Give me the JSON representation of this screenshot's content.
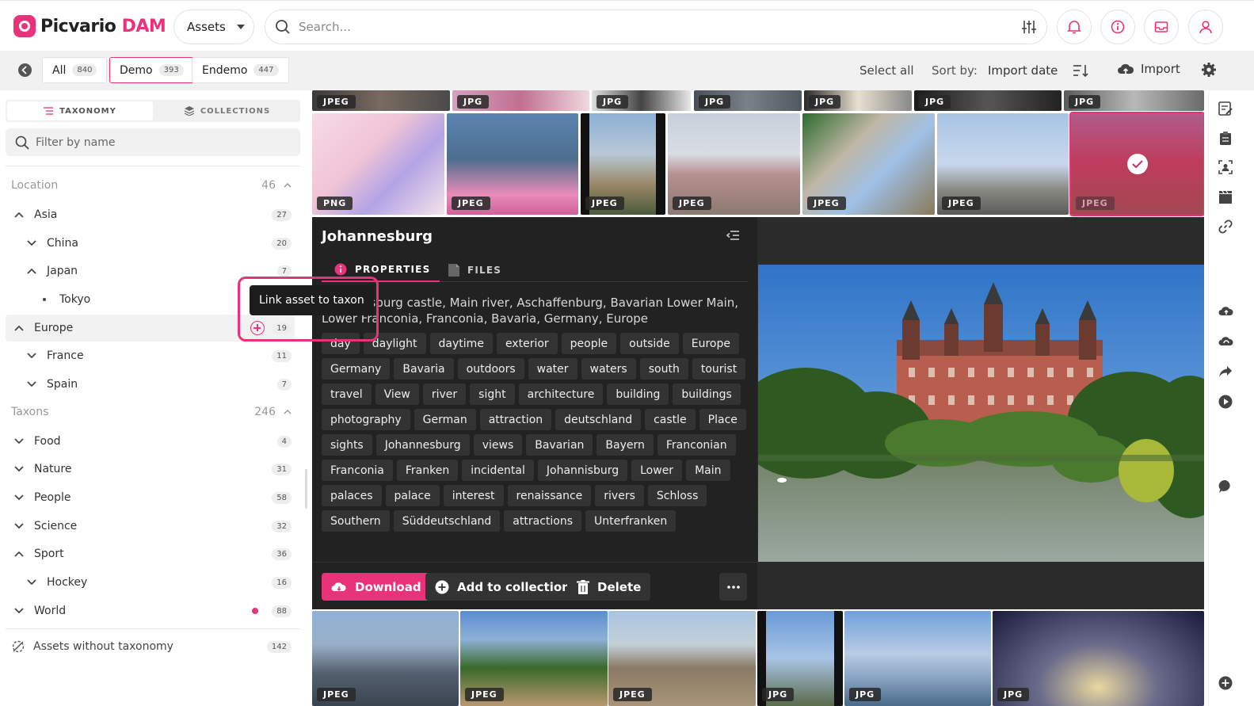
{
  "app": {
    "brand_prefix": "Picvario",
    "brand_suffix": "DAM",
    "colors": {
      "accent": "#e8337a",
      "panel_dark": "#222222"
    }
  },
  "header": {
    "assets_dropdown": "Assets",
    "search_placeholder": "Search..."
  },
  "filterbar": {
    "tabs": [
      {
        "label": "All",
        "count": "840"
      },
      {
        "label": "Demo",
        "count": "393"
      },
      {
        "label": "Endemo",
        "count": "447"
      }
    ],
    "select_all": "Select all",
    "sort_label": "Sort by:",
    "sort_value": "Import date",
    "import_label": "Import"
  },
  "sidebar": {
    "tabs": {
      "taxonomy": "TAXONOMY",
      "collections": "COLLECTIONS"
    },
    "filter_placeholder": "Filter by name",
    "location": {
      "label": "Location",
      "count": "46"
    },
    "taxons": {
      "label": "Taxons",
      "count": "246"
    },
    "tree": {
      "asia": {
        "label": "Asia",
        "count": "27"
      },
      "china": {
        "label": "China",
        "count": "20"
      },
      "japan": {
        "label": "Japan",
        "count": "7"
      },
      "tokyo": {
        "label": "Tokyo"
      },
      "europe": {
        "label": "Europe",
        "count": "19"
      },
      "france": {
        "label": "France",
        "count": "11"
      },
      "spain": {
        "label": "Spain",
        "count": "7"
      },
      "food": {
        "label": "Food",
        "count": "4"
      },
      "nature": {
        "label": "Nature",
        "count": "31"
      },
      "people": {
        "label": "People",
        "count": "58"
      },
      "science": {
        "label": "Science",
        "count": "32"
      },
      "sport": {
        "label": "Sport",
        "count": "36"
      },
      "hockey": {
        "label": "Hockey",
        "count": "16"
      },
      "world": {
        "label": "World",
        "count": "88"
      }
    },
    "no_taxonomy": {
      "label": "Assets without taxonomy",
      "count": "142"
    },
    "tooltip": "Link asset to taxon"
  },
  "grid": {
    "top_strip": [
      "JPEG",
      "JPG",
      "JPG",
      "JPG",
      "JPG",
      "JPG",
      "JPG"
    ],
    "row2": [
      "PNG",
      "JPEG",
      "JPEG",
      "JPEG",
      "JPEG",
      "JPEG",
      "JPEG"
    ],
    "bottom": [
      "JPEG",
      "JPEG",
      "JPEG",
      "JPG",
      "JPG",
      "JPG"
    ]
  },
  "detail": {
    "title": "Johannesburg",
    "tabs": {
      "properties": "PROPERTIES",
      "files": "FILES"
    },
    "description": "Johannesburg castle, Main river, Aschaffenburg, Bavarian Lower Main, Lower Franconia, Franconia, Bavaria, Germany, Europe",
    "tags": [
      "day",
      "daylight",
      "daytime",
      "exterior",
      "people",
      "outside",
      "Europe",
      "Germany",
      "Bavaria",
      "outdoors",
      "water",
      "waters",
      "south",
      "tourist",
      "travel",
      "View",
      "river",
      "sight",
      "architecture",
      "building",
      "buildings",
      "photography",
      "German",
      "attraction",
      "deutschland",
      "castle",
      "Place",
      "sights",
      "Johannesburg",
      "views",
      "Bavarian",
      "Bayern",
      "Franconian",
      "Franconia",
      "Franken",
      "incidental",
      "Johannisburg",
      "Lower",
      "Main",
      "palaces",
      "palace",
      "interest",
      "renaissance",
      "rivers",
      "Schloss",
      "Southern",
      "Süddeutschland",
      "attractions",
      "Unterfranken"
    ],
    "actions": {
      "download": "Download",
      "add_to_collection": "Add to collection",
      "delete": "Delete"
    }
  }
}
